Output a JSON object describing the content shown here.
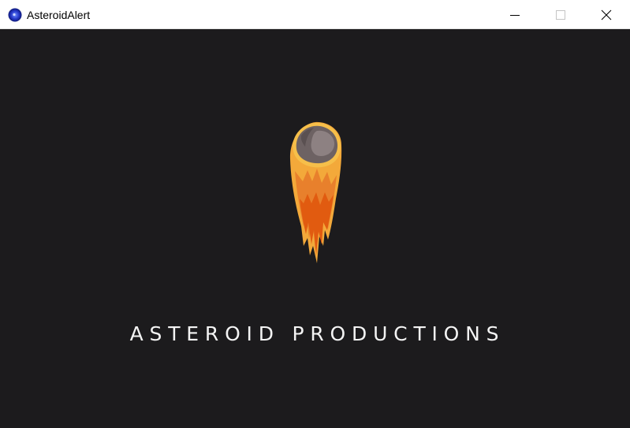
{
  "window": {
    "title": "AsteroidAlert",
    "icon": "asteroid-alert-app-icon",
    "controls": {
      "minimize_icon": "minimize-icon",
      "maximize_icon": "maximize-icon",
      "close_icon": "close-icon"
    }
  },
  "splash": {
    "studio_name": "ASTEROID PRODUCTIONS",
    "logo_icon": "flaming-asteroid-logo"
  },
  "colors": {
    "background": "#1c1b1d",
    "titlebar": "#ffffff",
    "text": "#f4f4f4",
    "flame_outer": "#f5b03c",
    "flame_mid": "#e9822d",
    "flame_inner": "#e05a0f",
    "rock": "#6f6464"
  }
}
